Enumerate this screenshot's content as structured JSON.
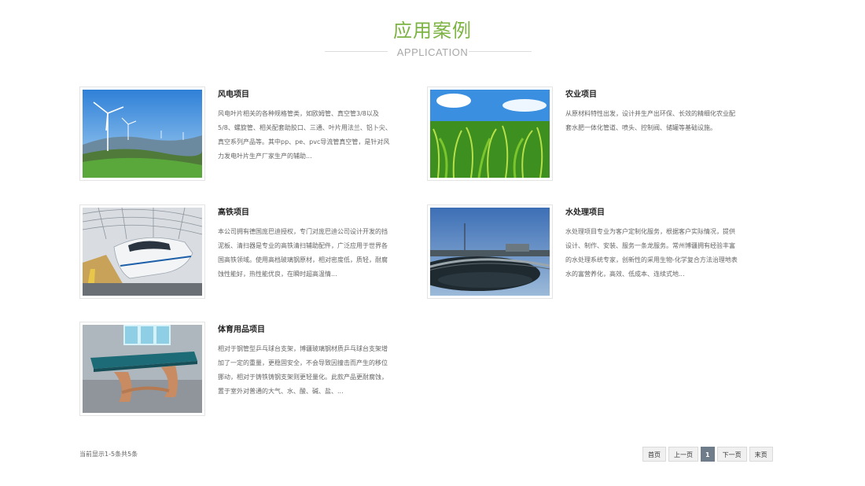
{
  "section": {
    "title": "应用案例",
    "subtitle": "APPLICATION"
  },
  "cases": [
    {
      "title": "风电项目",
      "desc": "风电叶片相关的各种规格管类，如欧姆管、真空管3/8以及5/8、螺旋管、相关配套助胶口、三通、叶片用法兰、铝卜尖、真空系列产品等。其中pp、pe、pvc导流管真空管，是针对风力发电叶片生产厂家生产的辅助...",
      "image": "wind-turbine-photo"
    },
    {
      "title": "农业项目",
      "desc": "从原材料特性出发，设计并生产出环保、长效的精细化农业配套水肥一体化管道、喷头、控制阀、储罐等基础设施。",
      "image": "corn-field-photo"
    },
    {
      "title": "高铁项目",
      "desc": "本公司拥有德国庞巴迪授权，专门对庞巴迪公司设计开发的挡泥板、清扫器是专业的高铁清扫辅助配件，广泛应用于世界各国高铁领域。使用高档玻璃钢原材，相对密度低，质轻，耐腐蚀性能好，热性能优良，在瞬时超高温情...",
      "image": "high-speed-train-photo"
    },
    {
      "title": "水处理项目",
      "desc": "水处理项目专业为客户定制化服务，根据客户实际情况，提供设计、制作、安装、服务一条龙服务。常州博疆拥有经验丰富的水处理系统专家，创新性的采用生物-化学复合方法治理地表水的富营养化，高效、低成本、连续式地...",
      "image": "water-treatment-photo"
    },
    {
      "title": "体育用品项目",
      "desc": "相对于钢管型乒乓球台支架，博疆玻璃钢材质乒乓球台支架增加了一定的重量，更稳固安全，不会导致因撞击而产生的移位挪动，相对于铸铁铸钢支架则更轻量化。此款产品更耐腐蚀，置于室外对普通的大气、水、酸、碱、盐、...",
      "image": "ping-pong-table-photo"
    }
  ],
  "footer": {
    "info": "当前显示1-5条共5条",
    "pagination": {
      "first": "首页",
      "prev": "上一页",
      "current": "1",
      "next": "下一页",
      "last": "末页"
    }
  }
}
